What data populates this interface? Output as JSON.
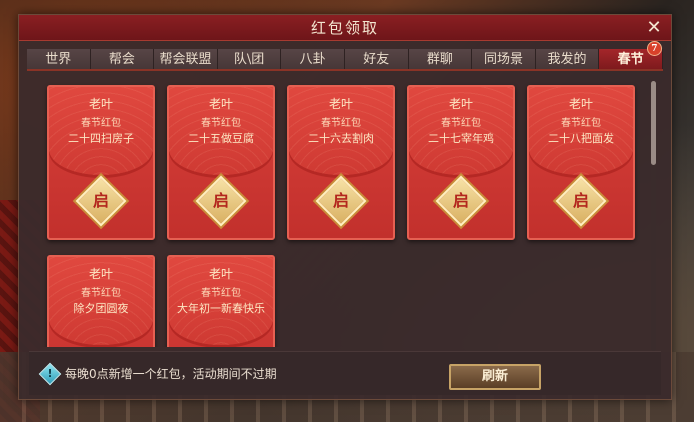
{
  "dialog": {
    "title": "红包领取",
    "close_glyph": "✕"
  },
  "tabs": [
    {
      "label": "世界",
      "active": false
    },
    {
      "label": "帮会",
      "active": false
    },
    {
      "label": "帮会联盟",
      "active": false
    },
    {
      "label": "队\\团",
      "active": false
    },
    {
      "label": "八卦",
      "active": false
    },
    {
      "label": "好友",
      "active": false
    },
    {
      "label": "群聊",
      "active": false
    },
    {
      "label": "同场景",
      "active": false
    },
    {
      "label": "我发的",
      "active": false
    },
    {
      "label": "春节",
      "active": true,
      "badge": "7"
    }
  ],
  "envelopes": [
    {
      "sender": "老叶",
      "type": "春节红包",
      "message": "二十四扫房子",
      "open_label": "启",
      "can_open": true
    },
    {
      "sender": "老叶",
      "type": "春节红包",
      "message": "二十五做豆腐",
      "open_label": "启",
      "can_open": true
    },
    {
      "sender": "老叶",
      "type": "春节红包",
      "message": "二十六去割肉",
      "open_label": "启",
      "can_open": true
    },
    {
      "sender": "老叶",
      "type": "春节红包",
      "message": "二十七宰年鸡",
      "open_label": "启",
      "can_open": true
    },
    {
      "sender": "老叶",
      "type": "春节红包",
      "message": "二十八把面发",
      "open_label": "启",
      "can_open": true
    },
    {
      "sender": "老叶",
      "type": "春节红包",
      "message": "除夕团圆夜",
      "open_label": "",
      "can_open": false
    },
    {
      "sender": "老叶",
      "type": "春节红包",
      "message": "大年初一新春快乐",
      "open_label": "",
      "can_open": false
    }
  ],
  "footer": {
    "info_icon": "info-diamond-icon",
    "notice": "每晚0点新增一个红包，活动期间不过期",
    "refresh_label": "刷新"
  },
  "colors": {
    "active_tab": "#a4262a",
    "envelope": "#d8403a",
    "gold": "#d9b062"
  }
}
